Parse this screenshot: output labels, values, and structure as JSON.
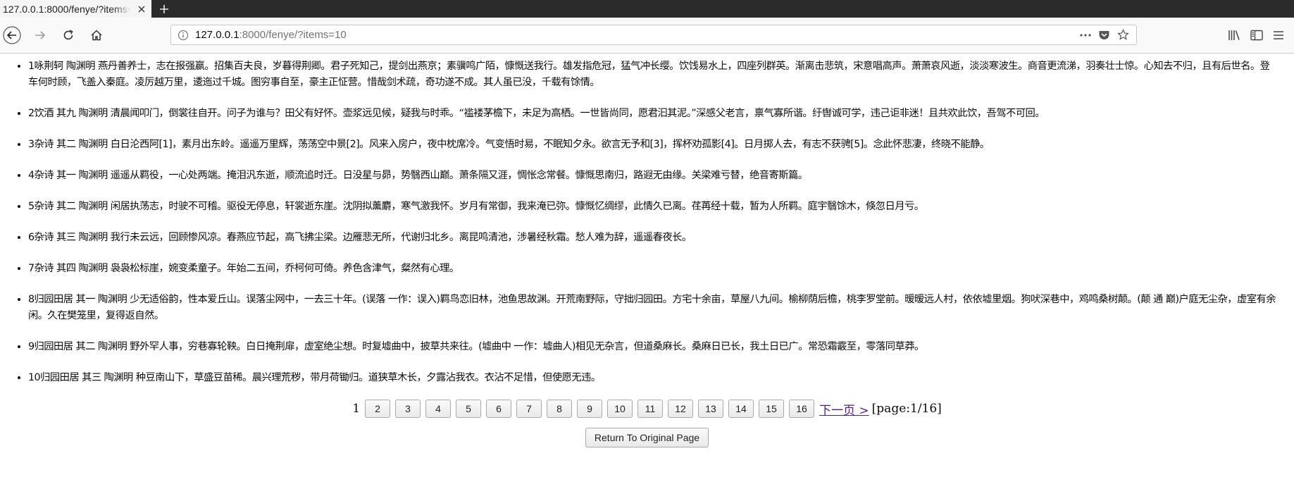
{
  "browser": {
    "tab_title": "127.0.0.1:8000/fenye/?items=",
    "url_host": "127.0.0.1",
    "url_rest": ":8000/fenye/?items=10"
  },
  "items": [
    "1咏荆轲 陶渊明 燕丹善养士，志在报强嬴。招集百夫良，岁暮得荆卿。君子死知己，提剑出燕京；素骥鸣广陌，慷慨送我行。雄发指危冠，猛气冲长缨。饮饯易水上，四座列群英。渐离击悲筑，宋意唱高声。萧萧哀风逝，淡淡寒波生。商音更流涕，羽奏壮士惊。心知去不归，且有后世名。登车何时顾，飞盖入秦庭。凌厉越万里，逶迤过千城。图穷事自至，豪主正怔营。惜哉剑术疏，奇功遂不成。其人虽已没，千载有馀情。",
    "2饮酒 其九 陶渊明 清晨闻叩门，倒裳往自开。问子为谁与？田父有好怀。壶浆远见候，疑我与时乖。“褴褛茅檐下，未足为高栖。一世皆尚同，愿君汩其泥。”深感父老言，禀气寡所谐。纡辔诚可学，违己讵非迷！且共欢此饮，吾驾不可回。",
    "3杂诗 其二 陶渊明 白日沦西阿[1]，素月出东岭。遥遥万里辉，荡荡空中景[2]。风来入房户，夜中枕席冷。气变悟时易，不眠知夕永。欲言无予和[3]，挥杯劝孤影[4]。日月掷人去，有志不获骋[5]。念此怀悲凄，终晓不能静。",
    "4杂诗 其一 陶渊明 遥遥从羁役，一心处两端。掩泪汎东逝，顺流追时迁。日没星与昴，势翳西山巅。萧条隔又涯，惆怅念常餐。慷慨思南归，路遐无由缘。关梁难亏替，绝音寄斯篇。",
    "5杂诗 其二 陶渊明 闲居执荡志，时驶不可稽。驱役无停息，轩裳逝东崖。沈阴拟薰麝，寒气激我怀。岁月有常御，我来淹已弥。慷慨忆绸缪，此情久已离。荏苒经十载，暂为人所羁。庭宇翳馀木，倏忽日月亏。",
    "6杂诗 其三 陶渊明 我行未云远，回顾惨风凉。春燕应节起，高飞拂尘梁。边雁悲无所，代谢归北乡。离昆鸣清池，涉暑经秋霜。愁人难为辞，遥遥春夜长。",
    "7杂诗 其四 陶渊明 袅袅松标崖，婉变柔童子。年始二五间，乔柯何可倚。养色含津气，粲然有心理。",
    "8归园田居 其一 陶渊明 少无适俗韵，性本爱丘山。误落尘网中，一去三十年。(误落 一作：误入)羁鸟恋旧林，池鱼思故渊。开荒南野际，守拙归园田。方宅十余亩，草屋八九间。榆柳荫后檐，桃李罗堂前。暧暧远人村，依依墟里烟。狗吠深巷中，鸡鸣桑树颠。(颠 通 巅)户庭无尘杂，虚室有余闲。久在樊笼里，复得返自然。",
    "9归园田居 其二 陶渊明 野外罕人事，穷巷寡轮鞅。白日掩荆扉，虚室绝尘想。时复墟曲中，披草共来往。(墟曲中 一作：墟曲人)相见无杂言，但道桑麻长。桑麻日已长，我土日已广。常恐霜霰至，零落同草莽。",
    "10归园田居 其三 陶渊明 种豆南山下，草盛豆苗稀。晨兴理荒秽，带月荷锄归。道狭草木长，夕露沾我衣。衣沾不足惜，但使愿无违。"
  ],
  "pagination": {
    "current": "1",
    "pages": [
      "2",
      "3",
      "4",
      "5",
      "6",
      "7",
      "8",
      "9",
      "10",
      "11",
      "12",
      "13",
      "14",
      "15",
      "16"
    ],
    "next_label": "下一页 >",
    "info": "[page:1/16]"
  },
  "return_label": "Return To Original Page"
}
